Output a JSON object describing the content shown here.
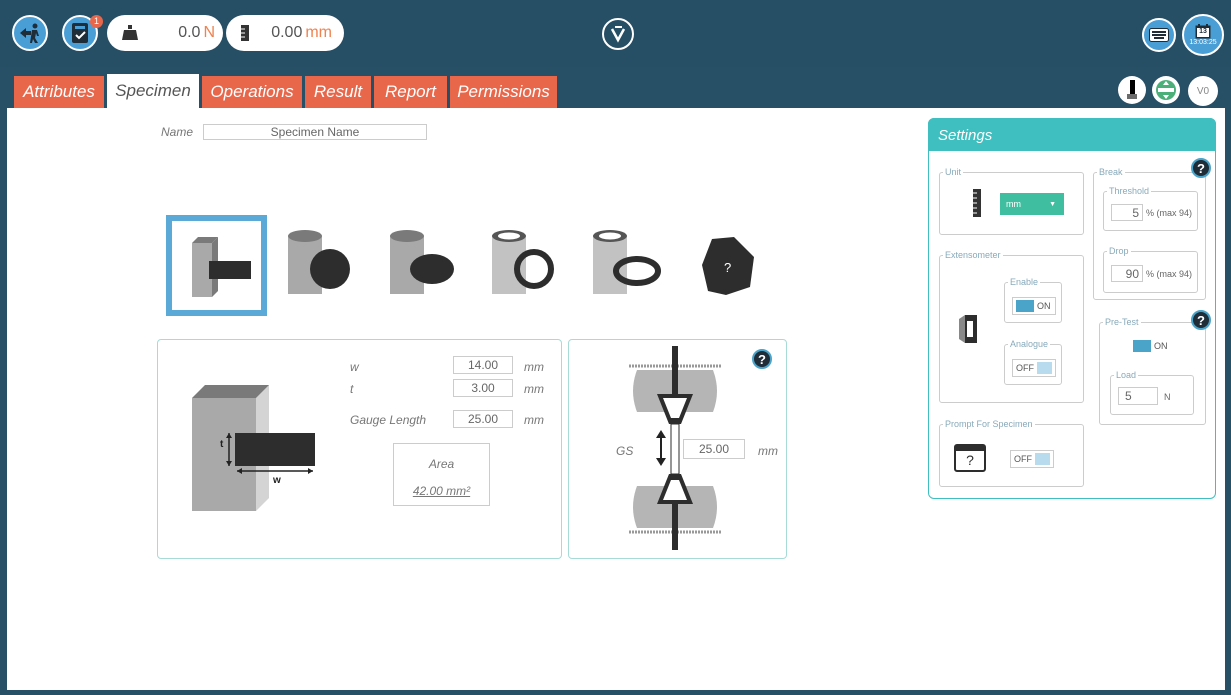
{
  "topbar": {
    "notification_count": "1",
    "force": {
      "value": "0.0",
      "unit": "N"
    },
    "position": {
      "value": "0.00",
      "unit": "mm"
    },
    "clock": "13:03:25",
    "calendar_day": "13",
    "version": "V0"
  },
  "tabs": [
    {
      "label": "Attributes"
    },
    {
      "label": "Specimen"
    },
    {
      "label": "Operations"
    },
    {
      "label": "Result"
    },
    {
      "label": "Report"
    },
    {
      "label": "Permissions"
    }
  ],
  "specimen": {
    "name_label": "Name",
    "name_value": "Specimen Name",
    "shape_unknown_label": "?",
    "dims": {
      "w_label": "w",
      "w_value": "14.00",
      "w_unit": "mm",
      "t_label": "t",
      "t_value": "3.00",
      "t_unit": "mm",
      "gl_label": "Gauge Length",
      "gl_value": "25.00",
      "gl_unit": "mm"
    },
    "area_label": "Area",
    "area_value": "42.00 mm²",
    "diagram_t": "t",
    "diagram_w": "w",
    "gs_label": "GS",
    "gs_value": "25.00",
    "gs_unit": "mm"
  },
  "settings": {
    "title": "Settings",
    "unit_group": "Unit",
    "unit_value": "mm",
    "break_group": "Break",
    "threshold_group": "Threshold",
    "threshold_value": "5",
    "threshold_suffix": "% (max 94)",
    "drop_group": "Drop",
    "drop_value": "90",
    "drop_suffix": "% (max 94)",
    "extensometer_group": "Extensometer",
    "enable_group": "Enable",
    "enable_state": "ON",
    "analogue_group": "Analogue",
    "analogue_state": "OFF",
    "pretest_group": "Pre-Test",
    "pretest_state": "ON",
    "load_group": "Load",
    "load_value": "5",
    "load_unit": "N",
    "prompt_group": "Prompt For Specimen",
    "prompt_state": "OFF",
    "prompt_icon_text": "?"
  },
  "colors": {
    "accent": "#e8674a",
    "teal": "#3fbfc0",
    "blue": "#4a9ed6",
    "dark": "#264f66"
  }
}
